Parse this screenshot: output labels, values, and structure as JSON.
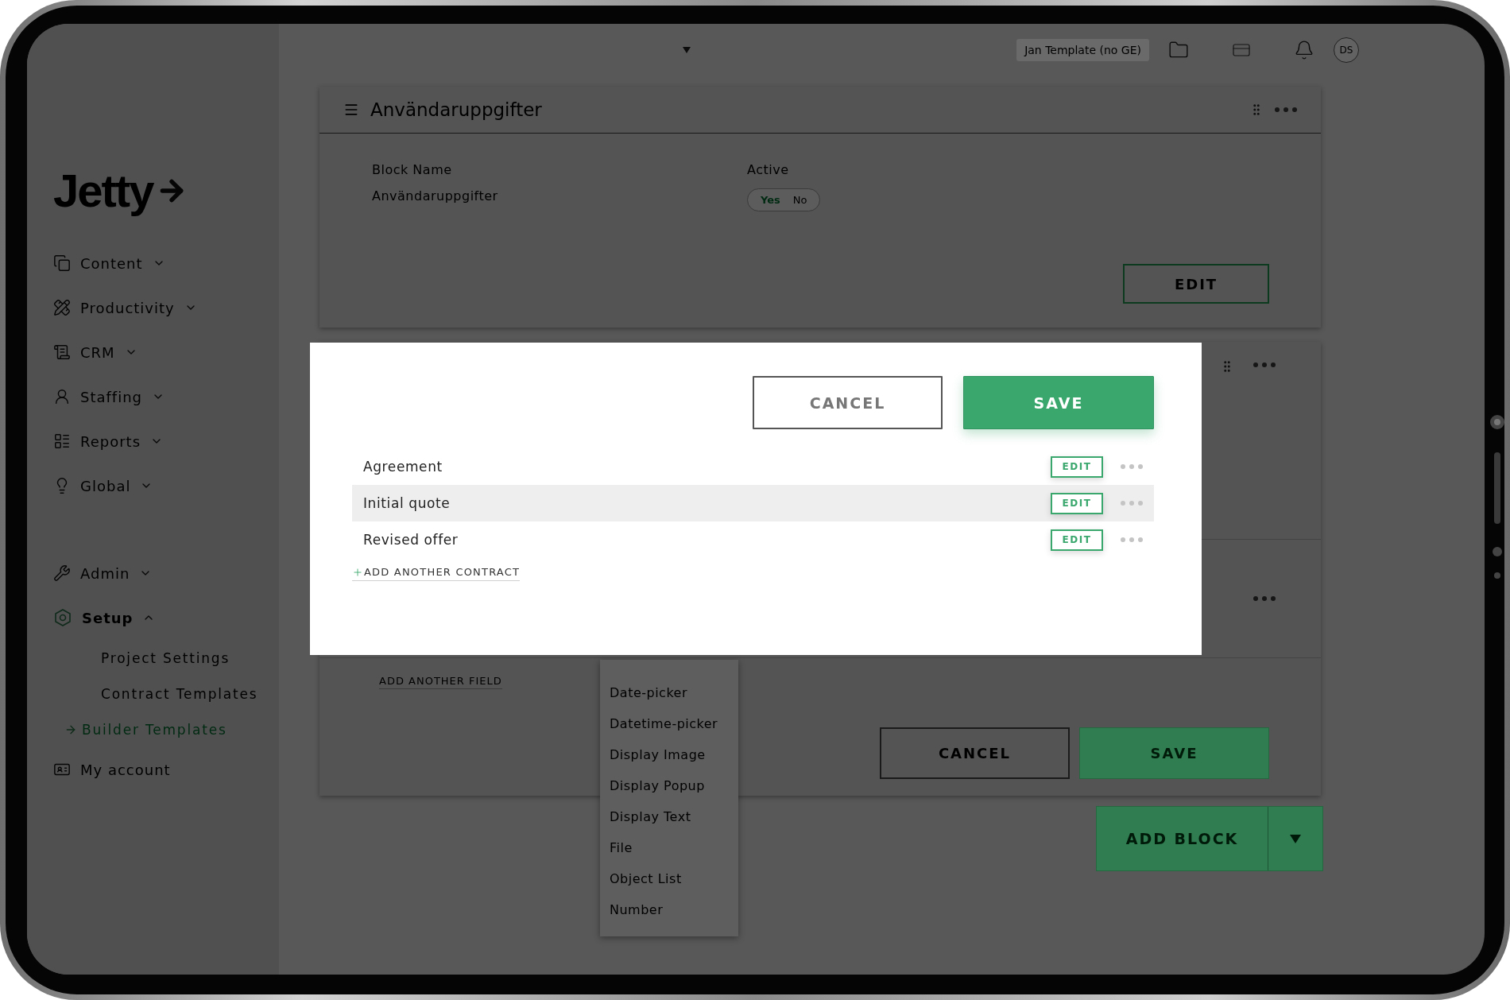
{
  "sidebar": {
    "logo": "Jetty",
    "nav_groups": [
      {
        "items": [
          {
            "label": "Content",
            "expanded": false
          },
          {
            "label": "Productivity",
            "expanded": false
          },
          {
            "label": "CRM",
            "expanded": false
          },
          {
            "label": "Staffing",
            "expanded": false
          },
          {
            "label": "Reports",
            "expanded": false
          },
          {
            "label": "Global",
            "expanded": false
          }
        ]
      },
      {
        "items": [
          {
            "label": "Admin",
            "expanded": false
          },
          {
            "label": "Setup",
            "expanded": true,
            "children": [
              {
                "label": "Project Settings",
                "selected": false
              },
              {
                "label": "Contract Templates",
                "selected": false
              },
              {
                "label": "Builder Templates",
                "selected": true
              }
            ]
          },
          {
            "label": "My account"
          }
        ]
      }
    ]
  },
  "topbar": {
    "template_chip": "Jan Template (no GE)",
    "avatar": "DS"
  },
  "block_card": {
    "title": "Användaruppgifter",
    "block_name_label": "Block Name",
    "block_name_value": "Användaruppgifter",
    "active_label": "Active",
    "active_options": [
      {
        "label": "Yes",
        "selected": true
      },
      {
        "label": "No",
        "selected": false
      }
    ],
    "edit_button": "EDIT"
  },
  "field_card": {
    "add_field": "ADD ANOTHER FIELD",
    "cancel_button": "CANCEL",
    "save_button": "SAVE"
  },
  "type_dropdown": {
    "options": [
      "Date-picker",
      "Datetime-picker",
      "Display Image",
      "Display Popup",
      "Display Text",
      "File",
      "Object List",
      "Number"
    ]
  },
  "add_block": {
    "label": "ADD BLOCK"
  },
  "dialog": {
    "cancel_button": "CANCEL",
    "save_button": "SAVE",
    "contracts": [
      {
        "name": "Agreement",
        "action": "EDIT",
        "selected": false
      },
      {
        "name": "Initial quote",
        "action": "EDIT",
        "selected": true
      },
      {
        "name": "Revised offer",
        "action": "EDIT",
        "selected": false
      }
    ],
    "add_contract": "ADD ANOTHER CONTRACT"
  }
}
